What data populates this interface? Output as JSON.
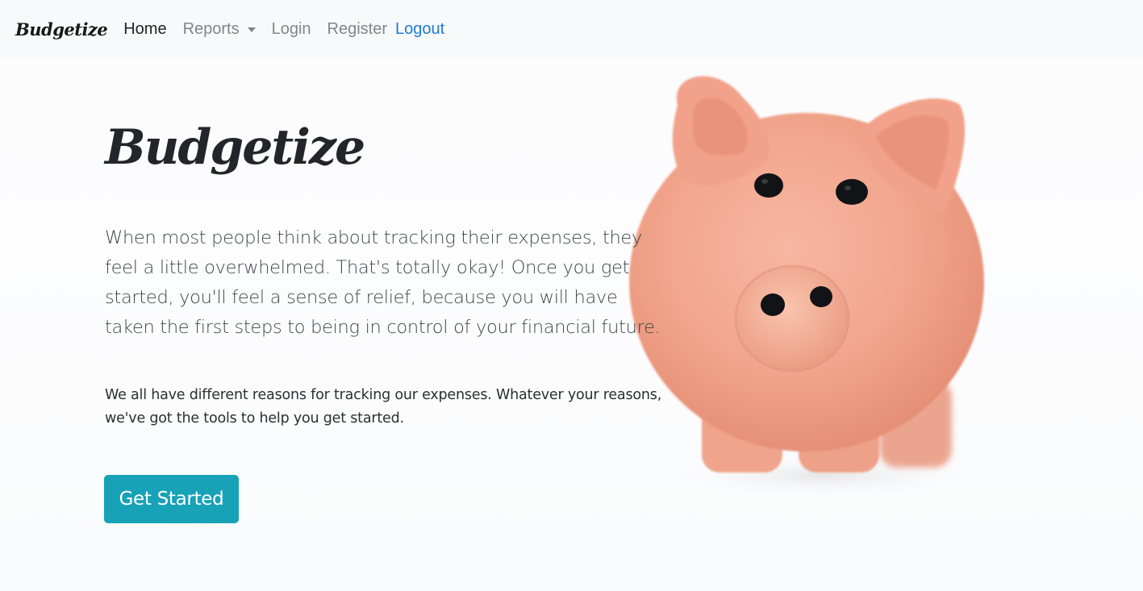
{
  "navbar": {
    "brand": "Budgetize",
    "items": [
      {
        "label": "Home",
        "active": true
      },
      {
        "label": "Reports",
        "dropdown": true
      },
      {
        "label": "Login"
      },
      {
        "label": "Register"
      },
      {
        "label": "Logout"
      }
    ]
  },
  "hero": {
    "title": "Budgetize",
    "lead": "When most people think about tracking their expenses, they feel a little overwhelmed. That's totally okay! Once you get started, you'll feel a sense of relief, because you will have taken the first steps to being in control of your financial future.",
    "subtext": "We all have different reasons for tracking our expenses. Whatever your reasons, we've got the tools to help you get started.",
    "cta_label": "Get Started",
    "image_icon": "piggy-bank-image"
  },
  "colors": {
    "accent": "#17a2b8",
    "logout_link": "#1d7bd6",
    "navbar_bg": "#f8f9fa",
    "pig_pink": "#f3a993"
  }
}
